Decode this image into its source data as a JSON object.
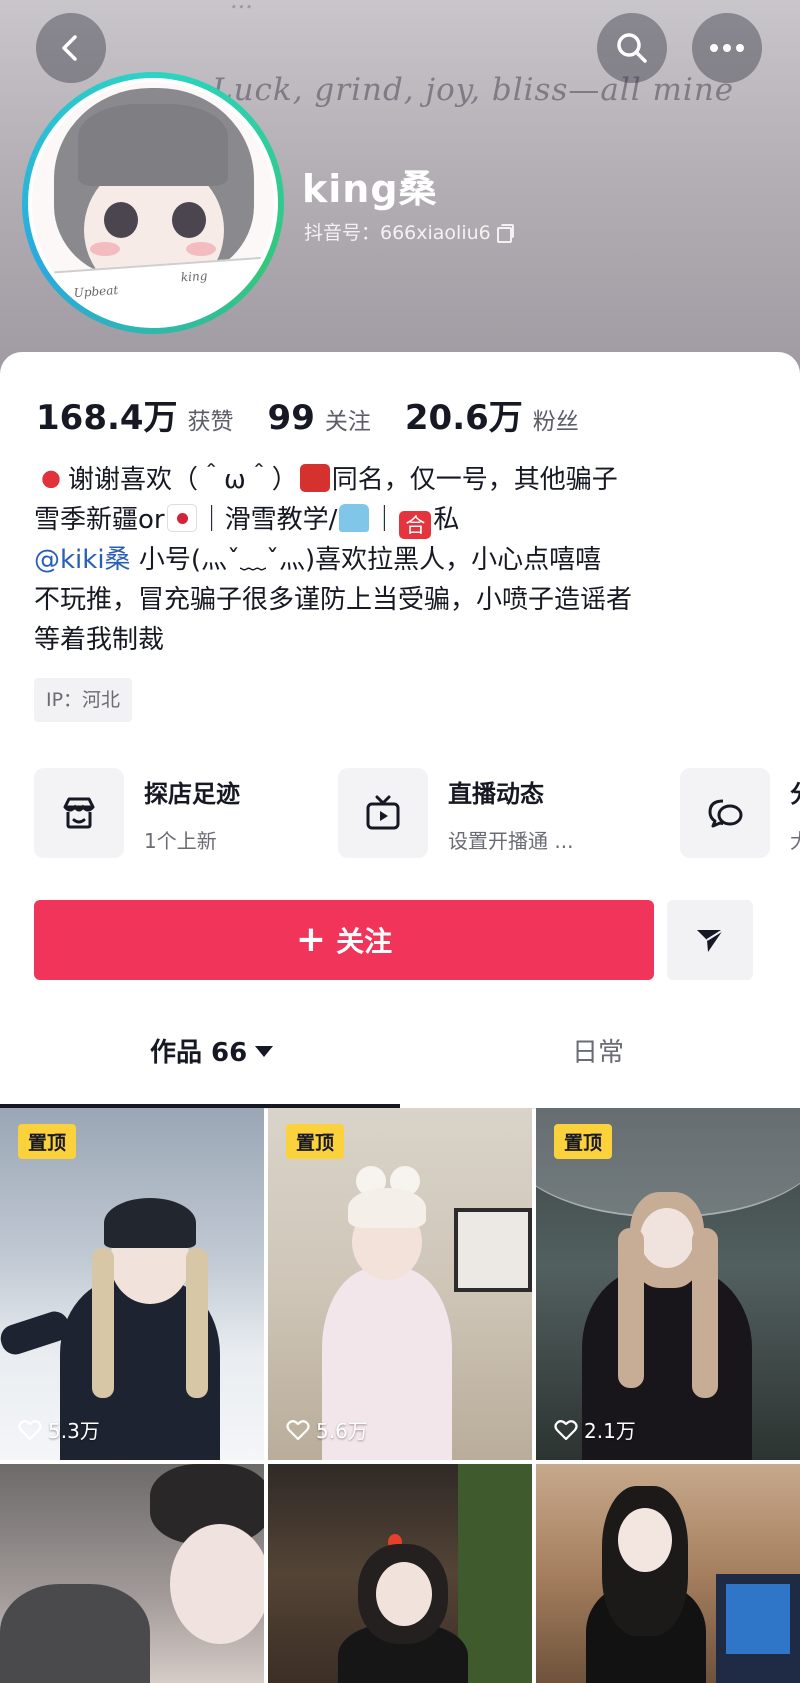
{
  "header": {
    "banner_text": "Luck, grind, joy, bliss—all mine",
    "banner_text_top": "...",
    "nickname": "king桑",
    "douyin_id": "抖音号：666xiaoliu6",
    "avatar_paper_left": "Upbeat",
    "avatar_paper_right": "king"
  },
  "stats": [
    {
      "value": "168.4万",
      "label": "获赞"
    },
    {
      "value": "99",
      "label": "关注"
    },
    {
      "value": "20.6万",
      "label": "粉丝"
    }
  ],
  "bio": {
    "line1_a": "谢谢喜欢（＾ω＾）",
    "line1_b": "同名，仅一号，其他骗子",
    "line2_a": "雪季新疆or",
    "line2_b": "｜滑雪教学/",
    "line2_c": "｜",
    "line2_he": "合",
    "line2_d": "私",
    "line3_mention": "@kiki桑",
    "line3_rest": " 小号(灬ˇ﹏ˇ灬)喜欢拉黑人，小心点嘻嘻",
    "line4": "不玩推，冒充骗子很多谨防上当受骗，小喷子造谣者",
    "line5": "等着我制裁"
  },
  "ip": "IP：河北",
  "shortcuts": [
    {
      "title": "探店足迹",
      "sub": "1个上新",
      "icon": "shop-icon"
    },
    {
      "title": "直播动态",
      "sub": "设置开播通 ...",
      "icon": "tv-icon"
    },
    {
      "title": "分",
      "sub": "大",
      "icon": "chat-icon"
    }
  ],
  "actions": {
    "follow_label": "关注",
    "follow_plus": "+"
  },
  "tabs": [
    {
      "label": "作品 66"
    },
    {
      "label": "日常"
    }
  ],
  "videos": [
    {
      "pinned": "置顶",
      "likes": "5.3万"
    },
    {
      "pinned": "置顶",
      "likes": "5.6万"
    },
    {
      "pinned": "置顶",
      "likes": "2.1万"
    },
    {
      "pinned": "",
      "likes": ""
    },
    {
      "pinned": "",
      "likes": ""
    },
    {
      "pinned": "",
      "likes": ""
    }
  ],
  "colors": {
    "accent": "#f0345a",
    "pin": "#fbd23c",
    "mention": "#2a5fb8"
  }
}
